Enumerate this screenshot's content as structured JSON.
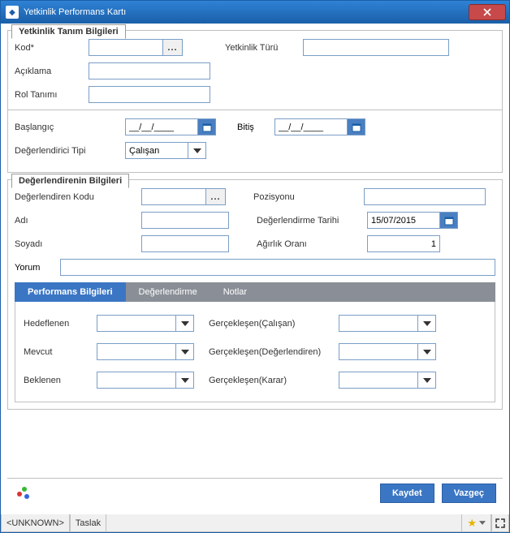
{
  "window": {
    "title": "Yetkinlik Performans Kartı"
  },
  "fs1": {
    "legend": "Yetkinlik Tanım Bilgileri",
    "kod_lbl": "Kod*",
    "kod_val": "",
    "tur_lbl": "Yetkinlik Türü",
    "tur_val": "",
    "aciklama_lbl": "Açıklama",
    "aciklama_val": "",
    "rol_lbl": "Rol Tanımı",
    "rol_val": "",
    "baslangic_lbl": "Başlangıç",
    "baslangic_val": "__/__/____",
    "bitis_lbl": "Bitiş",
    "bitis_val": "__/__/____",
    "degtip_lbl": "Değerlendirici Tipi",
    "degtip_val": "Çalışan"
  },
  "fs2": {
    "legend": "Değerlendirenin Bilgileri",
    "kod_lbl": "Değerlendiren Kodu",
    "kod_val": "",
    "poz_lbl": "Pozisyonu",
    "poz_val": "",
    "adi_lbl": "Adı",
    "adi_val": "",
    "tarih_lbl": "Değerlendirme Tarihi",
    "tarih_val": "15/07/2015",
    "soyadi_lbl": "Soyadı",
    "soyadi_val": "",
    "agirlik_lbl": "Ağırlık Oranı",
    "agirlik_val": "1",
    "yorum_lbl": "Yorum",
    "yorum_val": ""
  },
  "tabs": {
    "t1": "Performans Bilgileri",
    "t2": "Değerlendirme",
    "t3": "Notlar"
  },
  "perf": {
    "hedef_lbl": "Hedeflenen",
    "hedef_val": "",
    "gercC_lbl": "Gerçekleşen(Çalışan)",
    "gercC_val": "",
    "mevcut_lbl": "Mevcut",
    "mevcut_val": "",
    "gercD_lbl": "Gerçekleşen(Değerlendiren)",
    "gercD_val": "",
    "beklenen_lbl": "Beklenen",
    "beklenen_val": "",
    "gercK_lbl": "Gerçekleşen(Karar)",
    "gercK_val": ""
  },
  "buttons": {
    "save": "Kaydet",
    "cancel": "Vazgeç"
  },
  "status": {
    "unknown": "<UNKNOWN>",
    "taslak": "Taslak"
  }
}
